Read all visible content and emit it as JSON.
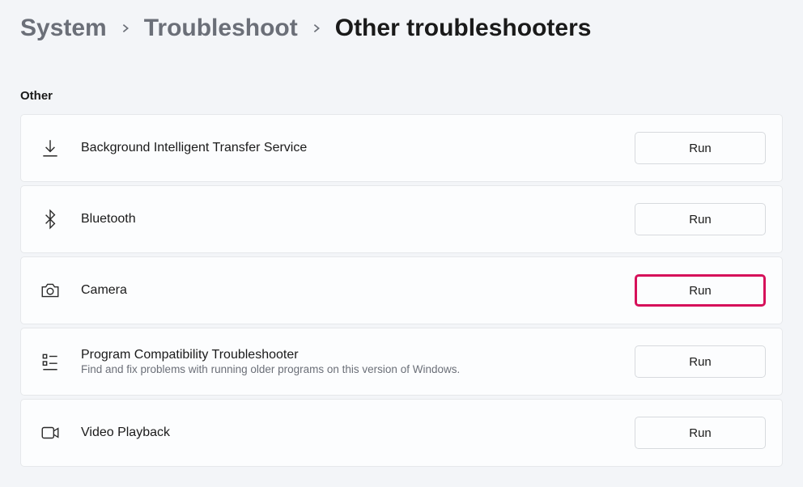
{
  "breadcrumb": {
    "system": "System",
    "troubleshoot": "Troubleshoot",
    "current": "Other troubleshooters"
  },
  "section_title": "Other",
  "items": {
    "bits": {
      "title": "Background Intelligent Transfer Service",
      "run": "Run"
    },
    "bluetooth": {
      "title": "Bluetooth",
      "run": "Run"
    },
    "camera": {
      "title": "Camera",
      "run": "Run"
    },
    "pct": {
      "title": "Program Compatibility Troubleshooter",
      "desc": "Find and fix problems with running older programs on this version of Windows.",
      "run": "Run"
    },
    "video": {
      "title": "Video Playback",
      "run": "Run"
    }
  }
}
